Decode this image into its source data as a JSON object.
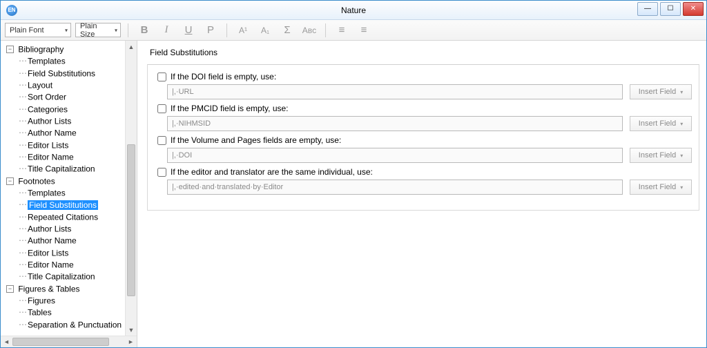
{
  "window": {
    "title": "Nature",
    "app_icon_text": "EN"
  },
  "toolbar": {
    "font_combo": "Plain Font",
    "size_combo": "Plain Size",
    "buttons": {
      "bold": "B",
      "italic": "I",
      "underline": "U",
      "plain": "P",
      "sup": "A¹",
      "sub": "A₁",
      "sigma": "Σ",
      "smallcaps": "Aʙᴄ",
      "align_left": "≡",
      "align_center": "≡"
    }
  },
  "tree": {
    "bibliography": {
      "label": "Bibliography",
      "children": [
        "Templates",
        "Field Substitutions",
        "Layout",
        "Sort Order",
        "Categories",
        "Author Lists",
        "Author Name",
        "Editor Lists",
        "Editor Name",
        "Title Capitalization"
      ]
    },
    "footnotes": {
      "label": "Footnotes",
      "children": [
        "Templates",
        "Field Substitutions",
        "Repeated Citations",
        "Author Lists",
        "Author Name",
        "Editor Lists",
        "Editor Name",
        "Title Capitalization"
      ]
    },
    "figures": {
      "label": "Figures & Tables",
      "children": [
        "Figures",
        "Tables",
        "Separation & Punctuation"
      ]
    },
    "selected": "Footnotes/Field Substitutions"
  },
  "main": {
    "panel_title": "Field Substitutions",
    "insert_field_label": "Insert Field",
    "subs": [
      {
        "label": "If the DOI field is empty, use:",
        "value": "|,·URL"
      },
      {
        "label": "If the PMCID field is empty, use:",
        "value": "|,·NIHMSID"
      },
      {
        "label": "If the Volume and Pages fields are empty, use:",
        "value": "|,·DOI"
      },
      {
        "label": "If the editor and translator are the same individual, use:",
        "value": "|,·edited·and·translated·by·Editor"
      }
    ]
  }
}
